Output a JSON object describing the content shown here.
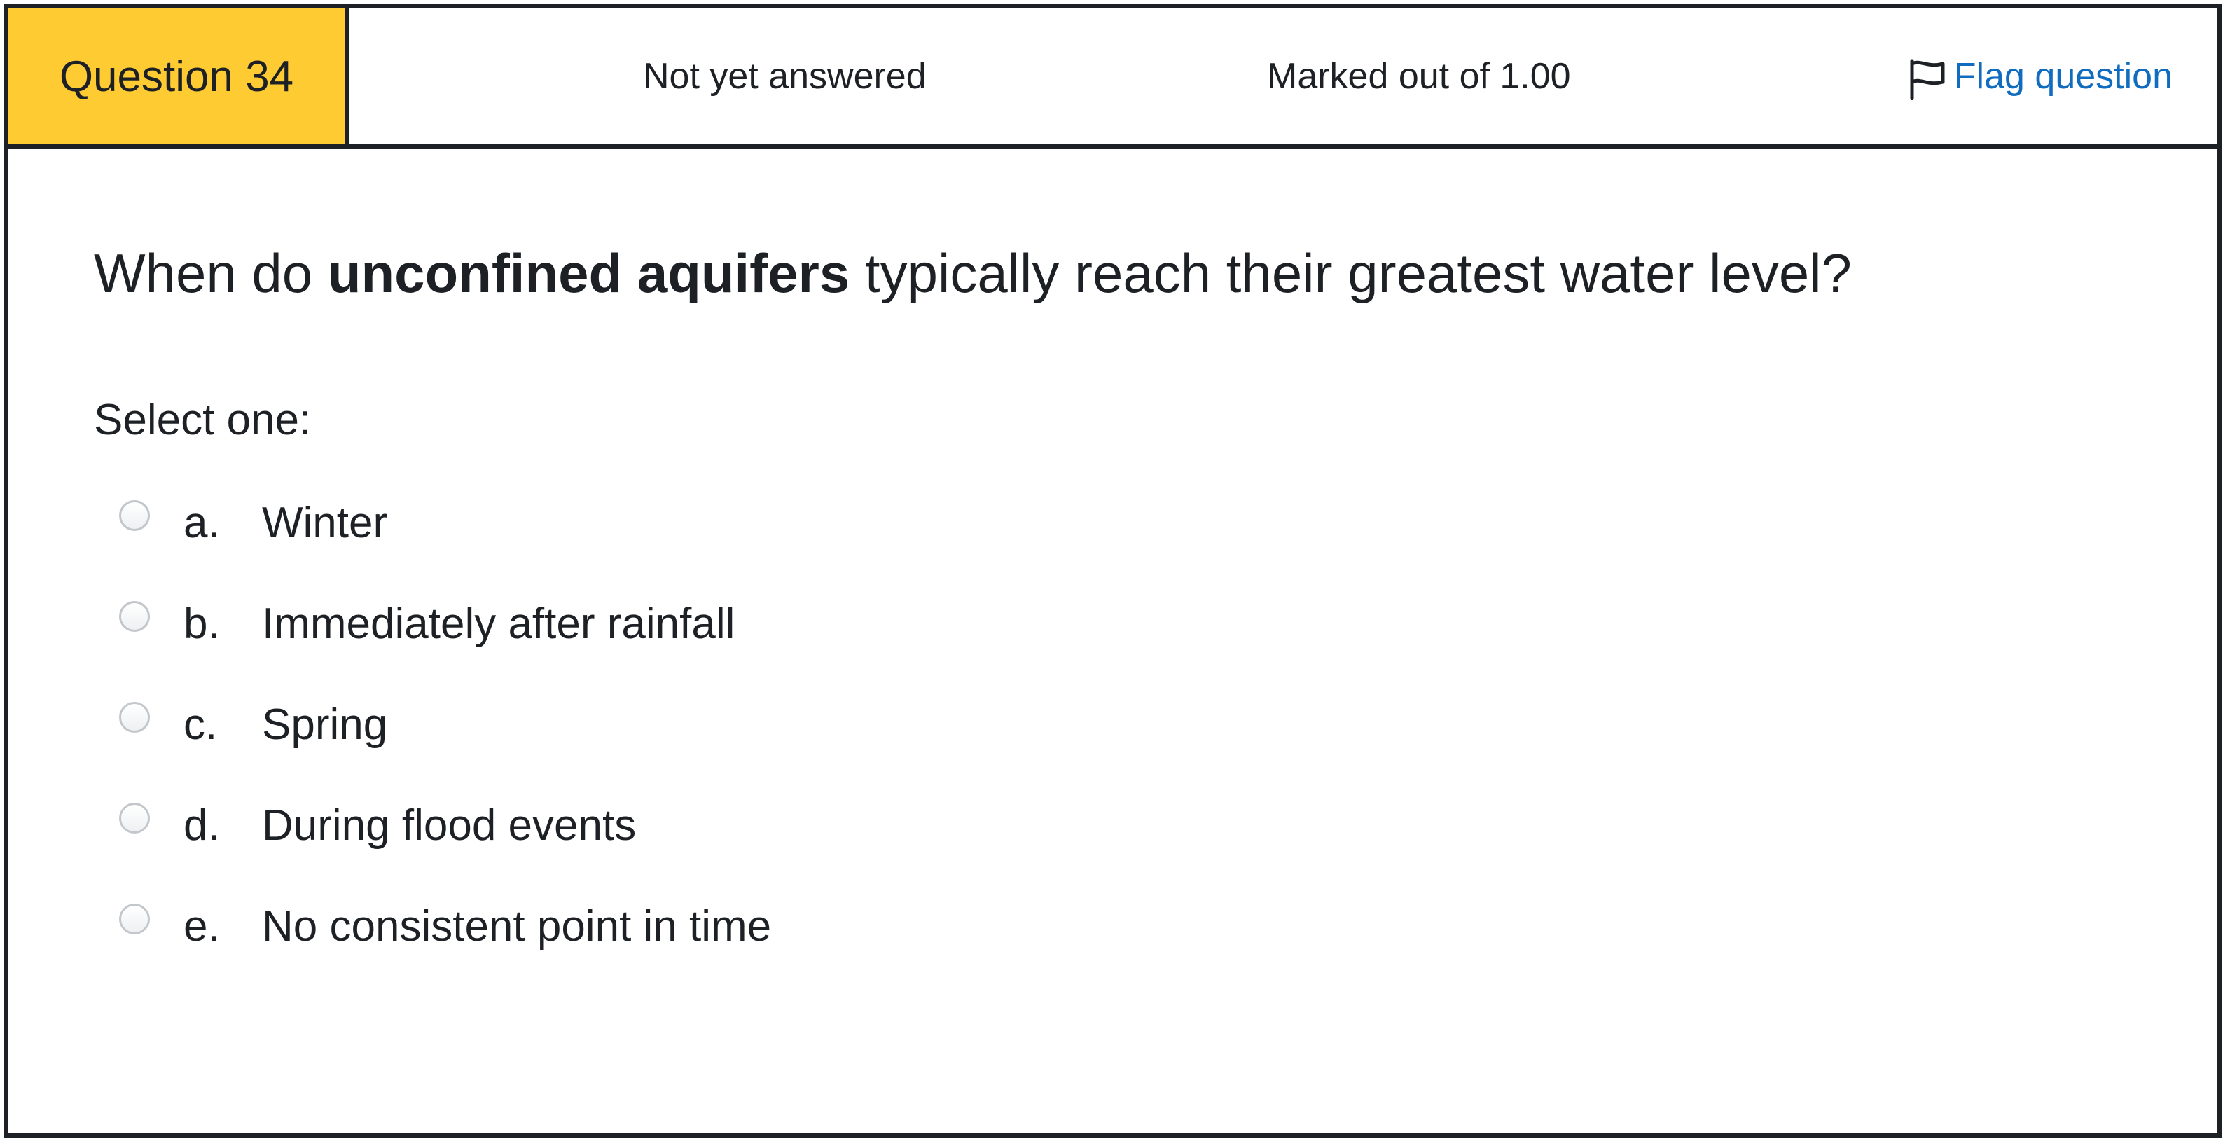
{
  "header": {
    "question_label": "Question 34",
    "status": "Not yet answered",
    "marked": "Marked out of 1.00",
    "flag_label": "Flag question"
  },
  "question": {
    "text_before": "When do ",
    "text_bold": "unconfined aquifers",
    "text_after": " typically reach their greatest water level?",
    "prompt": "Select one:"
  },
  "answers": [
    {
      "letter": "a.",
      "text": "Winter",
      "selected": false
    },
    {
      "letter": "b.",
      "text": "Immediately after rainfall",
      "selected": false
    },
    {
      "letter": "c.",
      "text": "Spring",
      "selected": false
    },
    {
      "letter": "d.",
      "text": "During flood events",
      "selected": false
    },
    {
      "letter": "e.",
      "text": "No consistent point in time",
      "selected": false
    }
  ],
  "colors": {
    "question_badge": "#ffcb33",
    "link": "#0f6cbf",
    "border": "#1d2125"
  },
  "icons": {
    "flag": "flag-icon",
    "radio": "radio-icon"
  }
}
